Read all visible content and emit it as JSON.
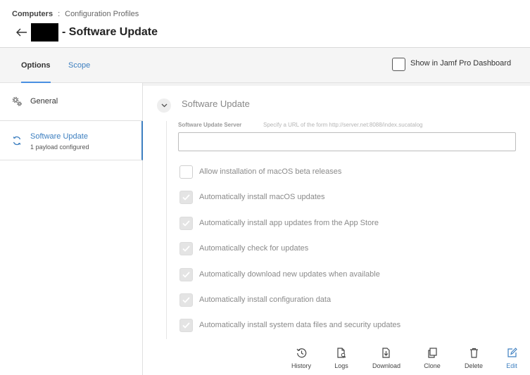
{
  "header": {
    "breadcrumb_root": "Computers",
    "breadcrumb_separator": ":",
    "breadcrumb_current": "Configuration Profiles",
    "title": "- Software Update"
  },
  "tabs": {
    "options": "Options",
    "scope": "Scope"
  },
  "dashboard_option": {
    "label": "Show in Jamf Pro Dashboard",
    "checked": false
  },
  "sidebar": {
    "items": [
      {
        "label": "General",
        "icon": "gear-icon"
      },
      {
        "label": "Software Update",
        "subtitle": "1 payload configured",
        "icon": "refresh-icon",
        "selected": true
      }
    ]
  },
  "panel": {
    "title": "Software Update",
    "server_label": "Software Update Server",
    "server_placeholder": "Specify a URL of the form http://server.net:8088/index.sucatalog",
    "server_value": "",
    "options": [
      {
        "label": "Allow installation of macOS beta releases",
        "checked": false
      },
      {
        "label": "Automatically install macOS updates",
        "checked": true
      },
      {
        "label": "Automatically install app updates from the App Store",
        "checked": true
      },
      {
        "label": "Automatically check for updates",
        "checked": true
      },
      {
        "label": "Automatically download new updates when available",
        "checked": true
      },
      {
        "label": "Automatically install configuration data",
        "checked": true
      },
      {
        "label": "Automatically install system data files and security updates",
        "checked": true
      }
    ]
  },
  "toolbar": {
    "history": "History",
    "logs": "Logs",
    "download": "Download",
    "clone": "Clone",
    "delete": "Delete",
    "edit": "Edit"
  },
  "colors": {
    "accent": "#3d7fc0",
    "tab_underline": "#4a90e2",
    "disabled_text": "#8a8a8a"
  }
}
